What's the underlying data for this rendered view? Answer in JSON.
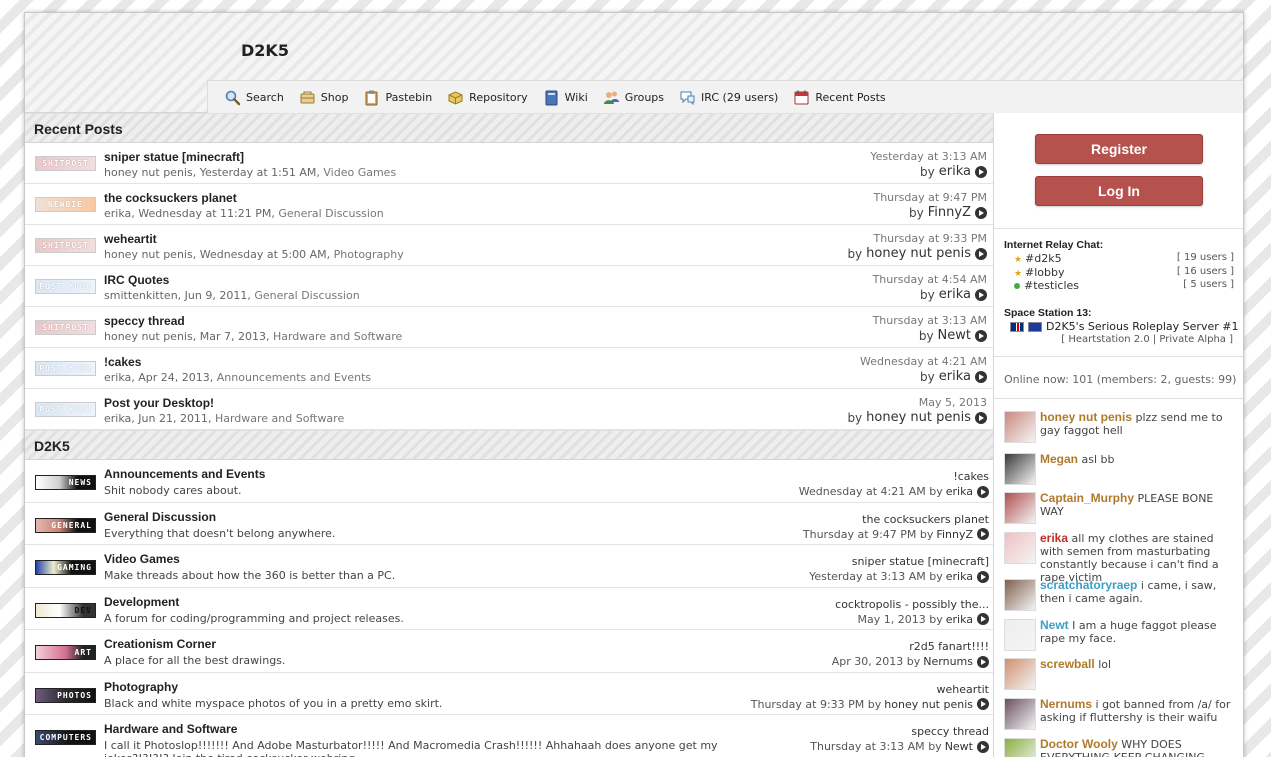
{
  "site": {
    "title": "D2K5"
  },
  "nav": [
    {
      "label": "Search",
      "icon": "search-icon"
    },
    {
      "label": "Shop",
      "icon": "shop-icon"
    },
    {
      "label": "Pastebin",
      "icon": "pastebin-icon"
    },
    {
      "label": "Repository",
      "icon": "repository-icon"
    },
    {
      "label": "Wiki",
      "icon": "wiki-icon"
    },
    {
      "label": "Groups",
      "icon": "groups-icon"
    },
    {
      "label": "IRC (29 users)",
      "icon": "irc-icon"
    },
    {
      "label": "Recent Posts",
      "icon": "calendar-icon"
    }
  ],
  "recent_posts": {
    "heading": "Recent Posts",
    "items": [
      {
        "badge": "SHITPOST",
        "title": "sniper statue [minecraft]",
        "author": "honey nut penis",
        "date": "Yesterday at 1:51 AM",
        "forum": "Video Games",
        "last_time": "Yesterday at 3:13 AM",
        "last_by_label": "by",
        "last_user": "erika"
      },
      {
        "badge": "NEWBIE",
        "title": "the cocksuckers planet",
        "author": "erika",
        "date": "Wednesday at 11:21 PM",
        "forum": "General Discussion",
        "last_time": "Thursday at 9:47 PM",
        "last_by_label": "by",
        "last_user": "FinnyZ"
      },
      {
        "badge": "SHITPOST",
        "title": "weheartit",
        "author": "honey nut penis",
        "date": "Wednesday at 5:00 AM",
        "forum": "Photography",
        "last_time": "Thursday at 9:33 PM",
        "last_by_label": "by",
        "last_user": "honey nut penis"
      },
      {
        "badge": "POST YOUR",
        "title": "IRC Quotes",
        "author": "smittenkitten",
        "date": "Jun 9, 2011",
        "forum": "General Discussion",
        "last_time": "Thursday at 4:54 AM",
        "last_by_label": "by",
        "last_user": "erika"
      },
      {
        "badge": "SHITPOST",
        "title": "speccy thread",
        "author": "honey nut penis",
        "date": "Mar 7, 2013",
        "forum": "Hardware and Software",
        "last_time": "Thursday at 3:13 AM",
        "last_by_label": "by",
        "last_user": "Newt"
      },
      {
        "badge": "POST YOUR",
        "title": "!cakes",
        "author": "erika",
        "date": "Apr 24, 2013",
        "forum": "Announcements and Events",
        "last_time": "Wednesday at 4:21 AM",
        "last_by_label": "by",
        "last_user": "erika"
      },
      {
        "badge": "POST YOUR",
        "title": "Post your Desktop!",
        "author": "erika",
        "date": "Jun 21, 2011",
        "forum": "Hardware and Software",
        "last_time": "May 5, 2013",
        "last_by_label": "by",
        "last_user": "honey nut penis"
      }
    ]
  },
  "forums": {
    "heading": "D2K5",
    "items": [
      {
        "badge": "NEWS",
        "name": "Announcements and Events",
        "desc": "Shit nobody cares about.",
        "last_title": "!cakes",
        "last_time": "Wednesday at 4:21 AM",
        "last_by_label": "by",
        "last_user": "erika"
      },
      {
        "badge": "GENERAL",
        "name": "General Discussion",
        "desc": "Everything that doesn't belong anywhere.",
        "last_title": "the cocksuckers planet",
        "last_time": "Thursday at 9:47 PM",
        "last_by_label": "by",
        "last_user": "FinnyZ"
      },
      {
        "badge": "GAMING",
        "name": "Video Games",
        "desc": "Make threads about how the 360 is better than a PC.",
        "last_title": "sniper statue [minecraft]",
        "last_time": "Yesterday at 3:13 AM",
        "last_by_label": "by",
        "last_user": "erika"
      },
      {
        "badge": "DEV",
        "name": "Development",
        "desc": "A forum for coding/programming and project releases.",
        "last_title": "cocktropolis - possibly the...",
        "last_time": "May 1, 2013",
        "last_by_label": "by",
        "last_user": "erika"
      },
      {
        "badge": "ART",
        "name": "Creationism Corner",
        "desc": "A place for all the best drawings.",
        "last_title": "r2d5 fanart!!!!",
        "last_time": "Apr 30, 2013",
        "last_by_label": "by",
        "last_user": "Nernums"
      },
      {
        "badge": "PHOTOS",
        "name": "Photography",
        "desc": "Black and white myspace photos of you in a pretty emo skirt.",
        "last_title": "weheartit",
        "last_time": "Thursday at 9:33 PM",
        "last_by_label": "by",
        "last_user": "honey nut penis"
      },
      {
        "badge": "COMPUTERS",
        "name": "Hardware and Software",
        "desc": "I call it Photoslop!!!!!!! And Adobe Masturbator!!!!! And Macromedia Crash!!!!!! Ahhahaah does anyone get my jokes?!?!?!? Join the tired cocksucker webring",
        "last_title": "speccy thread",
        "last_time": "Thursday at 3:13 AM",
        "last_by_label": "by",
        "last_user": "Newt"
      }
    ]
  },
  "sidebar": {
    "register_label": "Register",
    "login_label": "Log In",
    "irc_heading": "Internet Relay Chat:",
    "irc_channels": [
      {
        "name": "#d2k5",
        "users": "[ 19 users ]",
        "status": "star"
      },
      {
        "name": "#lobby",
        "users": "[ 16 users ]",
        "status": "star"
      },
      {
        "name": "#testicles",
        "users": "[ 5 users ]",
        "status": "online"
      }
    ],
    "ss13_heading": "Space Station 13:",
    "ss13_server": "D2K5's Serious Roleplay Server #1",
    "ss13_sub": "[ Heartstation 2.0 | Private Alpha ]",
    "online_now": "Online now: 101 (members: 2, guests: 99)",
    "chat": [
      {
        "user": "honey nut penis",
        "color": "#b07a2a",
        "text": "plzz send me to gay faggot hell"
      },
      {
        "user": "Megan",
        "color": "#b07a2a",
        "text": "asl bb"
      },
      {
        "user": "Captain_Murphy",
        "color": "#b07a2a",
        "text": "PLEASE BONE WAY"
      },
      {
        "user": "erika",
        "color": "#c0302a",
        "text": "all my clothes are stained with semen from masturbating constantly because i can't find a rape victim"
      },
      {
        "user": "scratchatoryraep",
        "color": "#3aa0c8",
        "text": "i came, i saw, then i came again."
      },
      {
        "user": "Newt",
        "color": "#3aa0c8",
        "text": "I am a huge faggot please rape my face."
      },
      {
        "user": "screwball",
        "color": "#b07a2a",
        "text": "lol"
      },
      {
        "user": "Nernums",
        "color": "#b07a2a",
        "text": "i got banned from /a/ for asking if fluttershy is their waifu"
      },
      {
        "user": "Doctor Wooly",
        "color": "#b07a2a",
        "text": "WHY DOES EVERYTHING KEEP CHANGING"
      }
    ]
  }
}
